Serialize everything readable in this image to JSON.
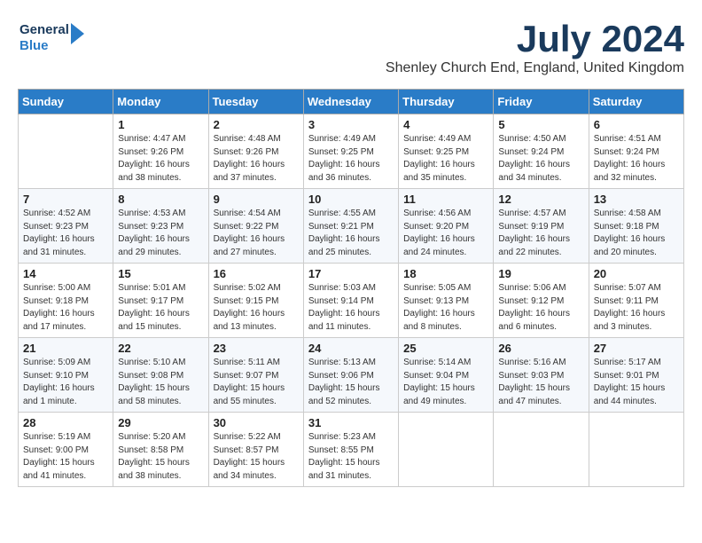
{
  "logo": {
    "line1": "General",
    "line2": "Blue",
    "icon_color": "#2a7cc7"
  },
  "title": "July 2024",
  "subtitle": "Shenley Church End, England, United Kingdom",
  "days_of_week": [
    "Sunday",
    "Monday",
    "Tuesday",
    "Wednesday",
    "Thursday",
    "Friday",
    "Saturday"
  ],
  "weeks": [
    [
      {
        "num": "",
        "info": ""
      },
      {
        "num": "1",
        "info": "Sunrise: 4:47 AM\nSunset: 9:26 PM\nDaylight: 16 hours\nand 38 minutes."
      },
      {
        "num": "2",
        "info": "Sunrise: 4:48 AM\nSunset: 9:26 PM\nDaylight: 16 hours\nand 37 minutes."
      },
      {
        "num": "3",
        "info": "Sunrise: 4:49 AM\nSunset: 9:25 PM\nDaylight: 16 hours\nand 36 minutes."
      },
      {
        "num": "4",
        "info": "Sunrise: 4:49 AM\nSunset: 9:25 PM\nDaylight: 16 hours\nand 35 minutes."
      },
      {
        "num": "5",
        "info": "Sunrise: 4:50 AM\nSunset: 9:24 PM\nDaylight: 16 hours\nand 34 minutes."
      },
      {
        "num": "6",
        "info": "Sunrise: 4:51 AM\nSunset: 9:24 PM\nDaylight: 16 hours\nand 32 minutes."
      }
    ],
    [
      {
        "num": "7",
        "info": "Sunrise: 4:52 AM\nSunset: 9:23 PM\nDaylight: 16 hours\nand 31 minutes."
      },
      {
        "num": "8",
        "info": "Sunrise: 4:53 AM\nSunset: 9:23 PM\nDaylight: 16 hours\nand 29 minutes."
      },
      {
        "num": "9",
        "info": "Sunrise: 4:54 AM\nSunset: 9:22 PM\nDaylight: 16 hours\nand 27 minutes."
      },
      {
        "num": "10",
        "info": "Sunrise: 4:55 AM\nSunset: 9:21 PM\nDaylight: 16 hours\nand 25 minutes."
      },
      {
        "num": "11",
        "info": "Sunrise: 4:56 AM\nSunset: 9:20 PM\nDaylight: 16 hours\nand 24 minutes."
      },
      {
        "num": "12",
        "info": "Sunrise: 4:57 AM\nSunset: 9:19 PM\nDaylight: 16 hours\nand 22 minutes."
      },
      {
        "num": "13",
        "info": "Sunrise: 4:58 AM\nSunset: 9:18 PM\nDaylight: 16 hours\nand 20 minutes."
      }
    ],
    [
      {
        "num": "14",
        "info": "Sunrise: 5:00 AM\nSunset: 9:18 PM\nDaylight: 16 hours\nand 17 minutes."
      },
      {
        "num": "15",
        "info": "Sunrise: 5:01 AM\nSunset: 9:17 PM\nDaylight: 16 hours\nand 15 minutes."
      },
      {
        "num": "16",
        "info": "Sunrise: 5:02 AM\nSunset: 9:15 PM\nDaylight: 16 hours\nand 13 minutes."
      },
      {
        "num": "17",
        "info": "Sunrise: 5:03 AM\nSunset: 9:14 PM\nDaylight: 16 hours\nand 11 minutes."
      },
      {
        "num": "18",
        "info": "Sunrise: 5:05 AM\nSunset: 9:13 PM\nDaylight: 16 hours\nand 8 minutes."
      },
      {
        "num": "19",
        "info": "Sunrise: 5:06 AM\nSunset: 9:12 PM\nDaylight: 16 hours\nand 6 minutes."
      },
      {
        "num": "20",
        "info": "Sunrise: 5:07 AM\nSunset: 9:11 PM\nDaylight: 16 hours\nand 3 minutes."
      }
    ],
    [
      {
        "num": "21",
        "info": "Sunrise: 5:09 AM\nSunset: 9:10 PM\nDaylight: 16 hours\nand 1 minute."
      },
      {
        "num": "22",
        "info": "Sunrise: 5:10 AM\nSunset: 9:08 PM\nDaylight: 15 hours\nand 58 minutes."
      },
      {
        "num": "23",
        "info": "Sunrise: 5:11 AM\nSunset: 9:07 PM\nDaylight: 15 hours\nand 55 minutes."
      },
      {
        "num": "24",
        "info": "Sunrise: 5:13 AM\nSunset: 9:06 PM\nDaylight: 15 hours\nand 52 minutes."
      },
      {
        "num": "25",
        "info": "Sunrise: 5:14 AM\nSunset: 9:04 PM\nDaylight: 15 hours\nand 49 minutes."
      },
      {
        "num": "26",
        "info": "Sunrise: 5:16 AM\nSunset: 9:03 PM\nDaylight: 15 hours\nand 47 minutes."
      },
      {
        "num": "27",
        "info": "Sunrise: 5:17 AM\nSunset: 9:01 PM\nDaylight: 15 hours\nand 44 minutes."
      }
    ],
    [
      {
        "num": "28",
        "info": "Sunrise: 5:19 AM\nSunset: 9:00 PM\nDaylight: 15 hours\nand 41 minutes."
      },
      {
        "num": "29",
        "info": "Sunrise: 5:20 AM\nSunset: 8:58 PM\nDaylight: 15 hours\nand 38 minutes."
      },
      {
        "num": "30",
        "info": "Sunrise: 5:22 AM\nSunset: 8:57 PM\nDaylight: 15 hours\nand 34 minutes."
      },
      {
        "num": "31",
        "info": "Sunrise: 5:23 AM\nSunset: 8:55 PM\nDaylight: 15 hours\nand 31 minutes."
      },
      {
        "num": "",
        "info": ""
      },
      {
        "num": "",
        "info": ""
      },
      {
        "num": "",
        "info": ""
      }
    ]
  ]
}
